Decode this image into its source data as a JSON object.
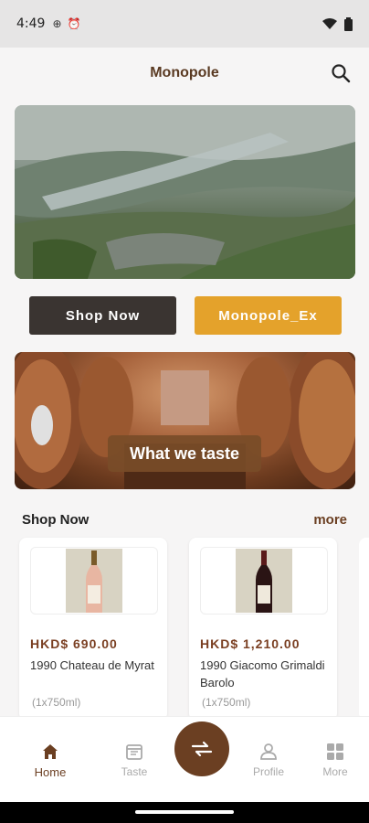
{
  "status": {
    "time": "4:49"
  },
  "app": {
    "title": "Monopole"
  },
  "buttons": {
    "shop_now": "Shop Now",
    "monopole_ex": "Monopole_Ex"
  },
  "banner": {
    "label": "What we taste"
  },
  "section": {
    "title": "Shop Now",
    "more": "more"
  },
  "products": [
    {
      "price": "HKD$ 690.00",
      "name": " 1990 Chateau de Myrat",
      "volume": "(1x750ml)"
    },
    {
      "price": "HKD$ 1,210.00",
      "name": " 1990 Giacomo Grimaldi Barolo",
      "volume": "(1x750ml)"
    }
  ],
  "nav": [
    {
      "label": "Home",
      "icon": "home-icon",
      "active": true
    },
    {
      "label": "Taste",
      "icon": "calendar-icon",
      "active": false
    },
    {
      "label": "",
      "icon": "swap-icon",
      "active": false
    },
    {
      "label": "Profile",
      "icon": "person-icon",
      "active": false
    },
    {
      "label": "More",
      "icon": "grid-icon",
      "active": false
    }
  ],
  "colors": {
    "accent_brown": "#6b3f22",
    "accent_orange": "#e4a22b",
    "dark_button": "#3a3431"
  }
}
